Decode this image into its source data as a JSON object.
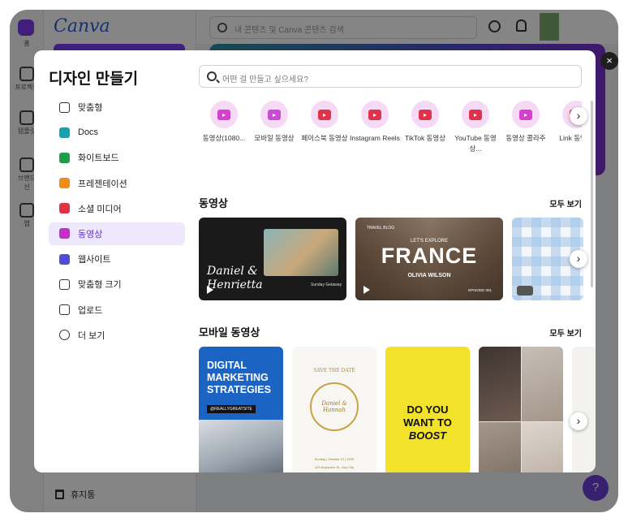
{
  "app": {
    "logo": "Canva",
    "top_search_placeholder": "내 콘텐츠 및 Canva 콘텐츠 검색",
    "rail": [
      "홈",
      "프로젝트",
      "템플릿",
      "브랜드 선",
      "앱"
    ],
    "trash_label": "휴지통",
    "help_label": "?"
  },
  "modal": {
    "title": "디자인 만들기",
    "close_label": "×",
    "search_placeholder": "어떤 걸 만들고 싶으세요?",
    "nav": [
      {
        "label": "맞춤형",
        "icon": "sparkle-icon",
        "color": "#333333"
      },
      {
        "label": "Docs",
        "icon": "docs-icon",
        "color": "#13a3b5"
      },
      {
        "label": "화이트보드",
        "icon": "whiteboard-icon",
        "color": "#1e9e4a"
      },
      {
        "label": "프레젠테이션",
        "icon": "presentation-icon",
        "color": "#f08c1a"
      },
      {
        "label": "소셜 미디어",
        "icon": "heart-icon",
        "color": "#e0334a"
      },
      {
        "label": "동영상",
        "icon": "video-icon",
        "color": "#c22fc9"
      },
      {
        "label": "웹사이트",
        "icon": "website-icon",
        "color": "#4b4fd8"
      },
      {
        "label": "맞춤형 크기",
        "icon": "custom-size-icon",
        "color": "#333333"
      },
      {
        "label": "업로드",
        "icon": "cloud-upload-icon",
        "color": "#333333"
      },
      {
        "label": "더 보기",
        "icon": "more-icon",
        "color": "#333333"
      }
    ],
    "active_nav": "동영상",
    "quick_types": [
      {
        "label": "동영상(1080...",
        "icon": "video-icon",
        "color": "#d63fd0"
      },
      {
        "label": "모바일 동영상",
        "icon": "mobile-video-icon",
        "color": "#c94bd6"
      },
      {
        "label": "페이스북 동영상",
        "icon": "facebook-icon",
        "color": "#e0334a"
      },
      {
        "label": "Instagram Reels",
        "icon": "instagram-icon",
        "color": "#e0334a"
      },
      {
        "label": "TikTok 동영상",
        "icon": "tiktok-icon",
        "color": "#e0334a"
      },
      {
        "label": "YouTube 동영상...",
        "icon": "youtube-icon",
        "color": "#e0334a"
      },
      {
        "label": "동영상 콜라주",
        "icon": "video-icon",
        "color": "#d63fd0"
      },
      {
        "label": "Link 동영상",
        "icon": "linkedin-icon",
        "color": "#e0334a"
      }
    ],
    "sections": {
      "video": {
        "title": "동영상",
        "see_all": "모두 보기",
        "cards": [
          {
            "script": "Daniel & Henrietta",
            "small": "Sunday Getaway",
            "name": "daniel-henrietta-card"
          },
          {
            "top": "LET'S EXPLORE",
            "big": "FRANCE",
            "sub": "OLIVIA WILSON",
            "tag": "TRAVEL BLOG",
            "ep": "EPISODE 001",
            "name": "france-travel-card"
          },
          {
            "name": "gingham-card"
          }
        ]
      },
      "mobile": {
        "title": "모바일 동영상",
        "see_all": "모두 보기",
        "cards": [
          {
            "lines": [
              "DIGITAL",
              "MARKETING",
              "STRATEGIES"
            ],
            "handle": "@REALLYGREATSITE"
          },
          {
            "top": "SAVE THE DATE",
            "names": "Daniel & Hannah",
            "date": "Sunday | October 21 | 2025",
            "place": "123 Anywhere St., Any City"
          },
          {
            "lines": [
              "DO YOU",
              "WANT TO",
              "BOOST"
            ]
          },
          {}
        ]
      }
    }
  }
}
